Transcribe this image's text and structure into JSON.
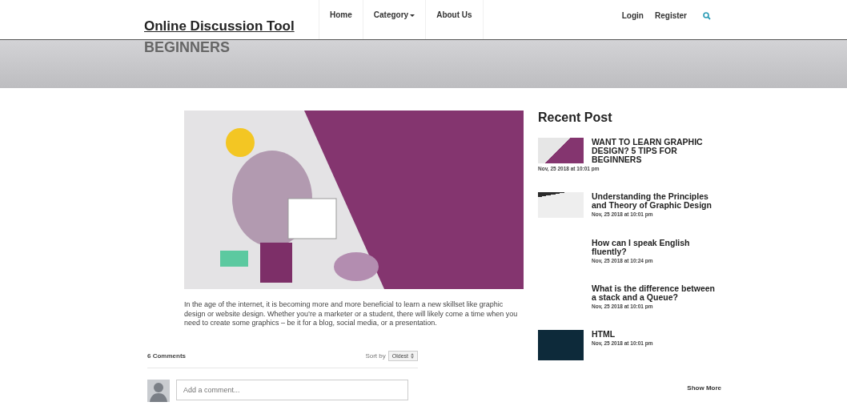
{
  "header": {
    "brand": "Online Discussion Tool",
    "nav": [
      {
        "label": "Home",
        "dropdown": false
      },
      {
        "label": "Category",
        "dropdown": true
      },
      {
        "label": "About Us",
        "dropdown": false
      }
    ],
    "account": [
      "Login",
      "Register"
    ]
  },
  "banner": {
    "title": "BEGINNERS"
  },
  "article": {
    "body": "In the age of the internet, it is becoming more and more beneficial to learn a new skillset like graphic design or website design. Whether you’re a marketer or a student, there will likely come a time when you need to create some graphics – be it for a blog, social media, or a presentation."
  },
  "comments": {
    "count": "6 Comments",
    "sort_label": "Sort by",
    "sort_value": "Oldest",
    "placeholder": "Add a comment..."
  },
  "recent": {
    "heading": "Recent Post",
    "posts": [
      {
        "kind": "image",
        "title": "WANT TO LEARN GRAPHIC DESIGN? 5 TIPS FOR BEGINNERS",
        "date": "Nov, 25 2018 at 10:01 pm"
      },
      {
        "kind": "image",
        "title": "Understanding the Principles and Theory of Graphic Design",
        "date": "Nov, 25 2018 at 10:01 pm"
      },
      {
        "kind": "no-image",
        "title": "How can I speak English fluently?",
        "date": "Nov, 25 2018 at 10:24 pm"
      },
      {
        "kind": "no-image",
        "title": "What is the difference between a stack and a Queue?",
        "date": "Nov, 25 2018 at 10:01 pm"
      },
      {
        "kind": "image",
        "title": "HTML",
        "date": "Nov, 25 2018 at 10:01 pm"
      }
    ],
    "more": "Show More"
  }
}
